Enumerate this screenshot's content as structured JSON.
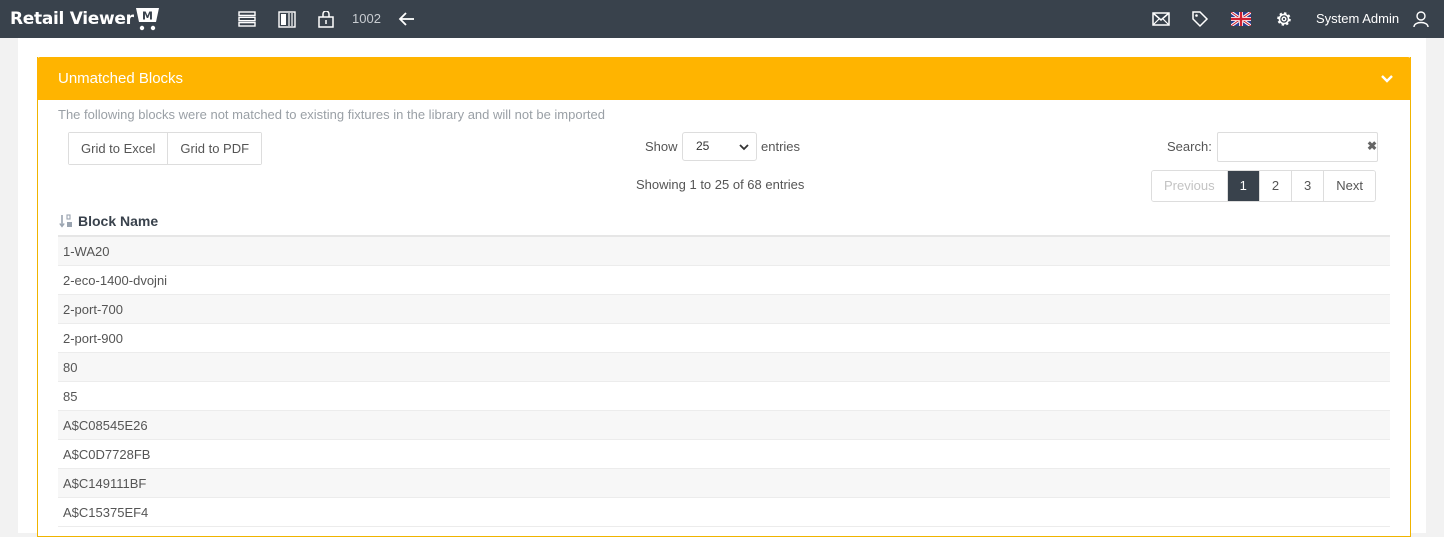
{
  "app": {
    "title": "Retail Viewer",
    "logo_letter": "M"
  },
  "topbar": {
    "item_number": "1002",
    "user_name": "System Admin",
    "icons": [
      "list-icon",
      "columns-icon",
      "store-icon",
      "back-arrow-icon",
      "mail-icon",
      "tag-icon",
      "uk-flag-icon",
      "gear-icon",
      "user-icon"
    ]
  },
  "panel": {
    "title": "Unmatched Blocks",
    "description": "The following blocks were not matched to existing fixtures in the library and will not be imported"
  },
  "toolbar": {
    "excel_label": "Grid to Excel",
    "pdf_label": "Grid to PDF"
  },
  "length": {
    "show_label": "Show",
    "value": "25",
    "entries_label": "entries"
  },
  "search": {
    "label": "Search:",
    "value": ""
  },
  "info": "Showing 1 to 25 of 68 entries",
  "pagination": {
    "previous": "Previous",
    "pages": [
      "1",
      "2",
      "3"
    ],
    "active": "1",
    "next": "Next"
  },
  "table": {
    "column": "Block Name",
    "rows": [
      "1-WA20",
      "2-eco-1400-dvojni",
      "2-port-700",
      "2-port-900",
      "80",
      "85",
      "A$C08545E26",
      "A$C0D7728FB",
      "A$C149111BF",
      "A$C15375EF4"
    ]
  },
  "colors": {
    "topbar": "#39424c",
    "accent": "#ffb400",
    "active_page": "#39424c"
  }
}
